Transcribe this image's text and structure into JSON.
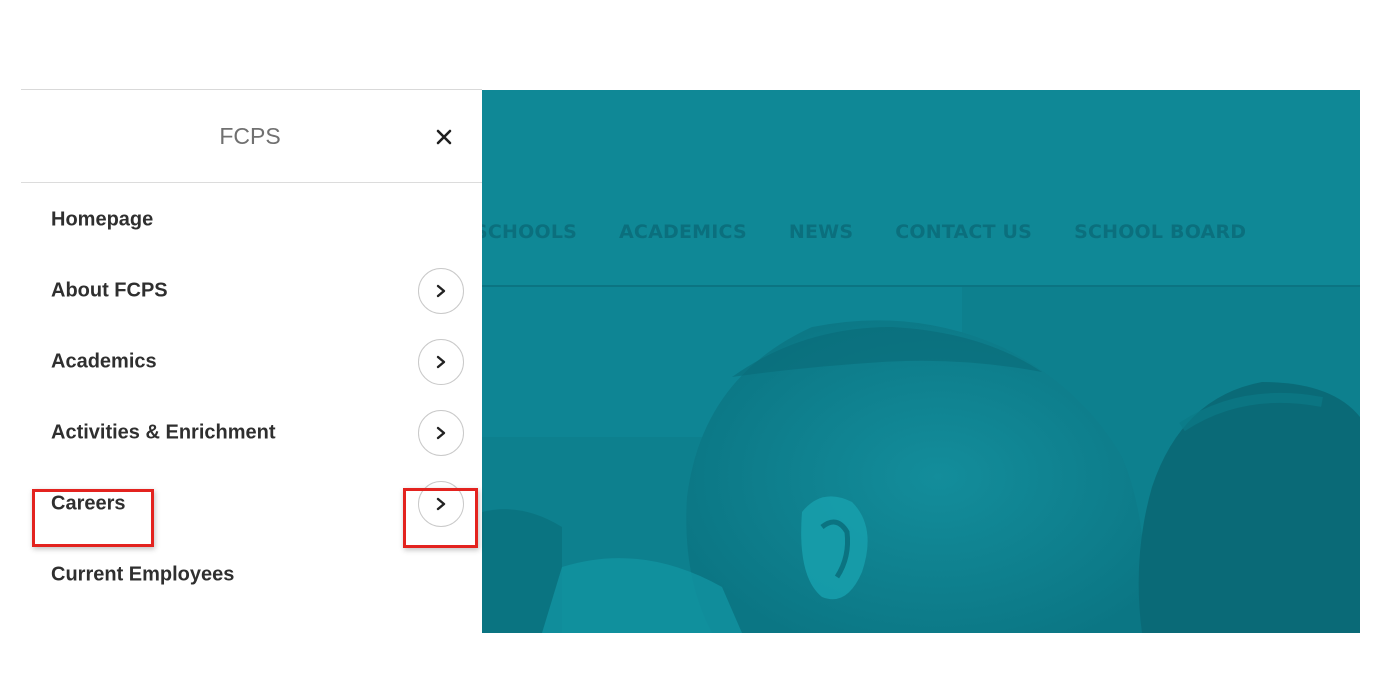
{
  "site_nav": {
    "items": [
      "SCHOOLS",
      "ACADEMICS",
      "NEWS",
      "CONTACT US",
      "SCHOOL BOARD"
    ]
  },
  "drawer": {
    "title": "FCPS",
    "close_icon": "close-icon",
    "items": [
      {
        "label": "Homepage",
        "has_submenu": false
      },
      {
        "label": "About FCPS",
        "has_submenu": true
      },
      {
        "label": "Academics",
        "has_submenu": true
      },
      {
        "label": "Activities & Enrichment",
        "has_submenu": true
      },
      {
        "label": "Careers",
        "has_submenu": true,
        "highlighted": true
      },
      {
        "label": "Current Employees",
        "has_submenu": false
      }
    ],
    "submenu_icon": "chevron-right-icon"
  },
  "colors": {
    "overlay_teal": "#0e8593",
    "nav_text": "#0b6f7d",
    "highlight_red": "#e3231f",
    "menu_text": "#2f2f2f"
  }
}
